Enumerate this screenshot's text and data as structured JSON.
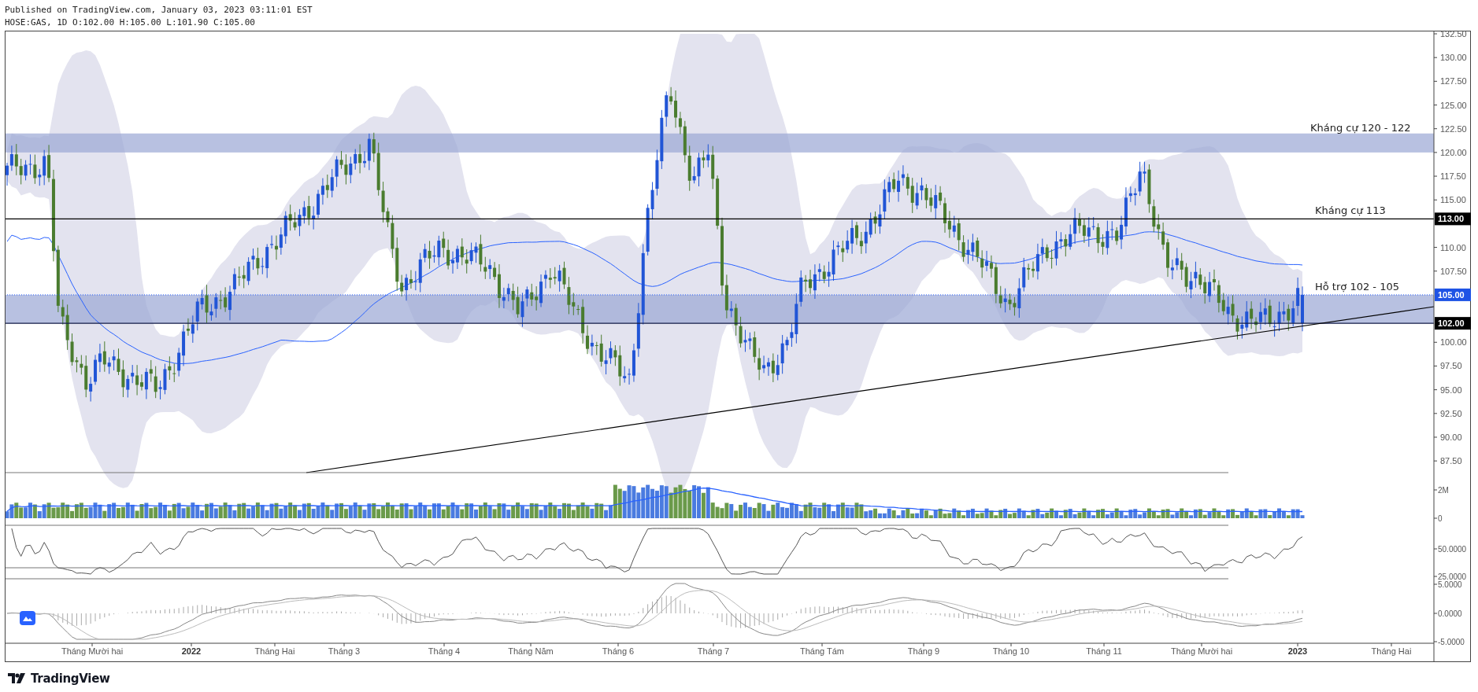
{
  "header": {
    "published": "Published on TradingView.com, January 03, 2023 03:11:01 EST",
    "symbol_line": "HOSE:GAS, 1D O:102.00 H:105.00 L:101.90 C:105.00"
  },
  "annotations": [
    {
      "text": "Kháng cự 120 - 122"
    },
    {
      "text": "Kháng cự 113"
    },
    {
      "text": "Hỗ trợ 102 - 105"
    }
  ],
  "price_axis": [
    "132.50",
    "130.00",
    "127.50",
    "125.00",
    "122.50",
    "120.00",
    "117.50",
    "115.00",
    "110.00",
    "107.50",
    "100.00",
    "97.50",
    "95.00",
    "92.50",
    "90.00",
    "87.50"
  ],
  "price_labels": [
    {
      "text": "113.00",
      "kind": "line"
    },
    {
      "text": "105.00",
      "kind": "last"
    },
    {
      "text": "102.00",
      "kind": "line"
    }
  ],
  "volume_axis": [
    "2M",
    "0"
  ],
  "rsi_axis": [
    "50.0000",
    "25.0000"
  ],
  "macd_axis": [
    "5.0000",
    "0.0000",
    "-5.0000"
  ],
  "time_axis": [
    {
      "label": "Tháng Mười hai",
      "bold": false
    },
    {
      "label": "2022",
      "bold": true
    },
    {
      "label": "Tháng Hai",
      "bold": false
    },
    {
      "label": "Tháng 3",
      "bold": false
    },
    {
      "label": "Tháng 4",
      "bold": false
    },
    {
      "label": "Tháng Năm",
      "bold": false
    },
    {
      "label": "Tháng 6",
      "bold": false
    },
    {
      "label": "Tháng 7",
      "bold": false
    },
    {
      "label": "Tháng Tám",
      "bold": false
    },
    {
      "label": "Tháng 9",
      "bold": false
    },
    {
      "label": "Tháng 10",
      "bold": false
    },
    {
      "label": "Tháng 11",
      "bold": false
    },
    {
      "label": "Tháng Mười hai",
      "bold": false
    },
    {
      "label": "2023",
      "bold": true
    },
    {
      "label": "Tháng Hai",
      "bold": false
    }
  ],
  "logo": {
    "text": "TradingView"
  }
}
